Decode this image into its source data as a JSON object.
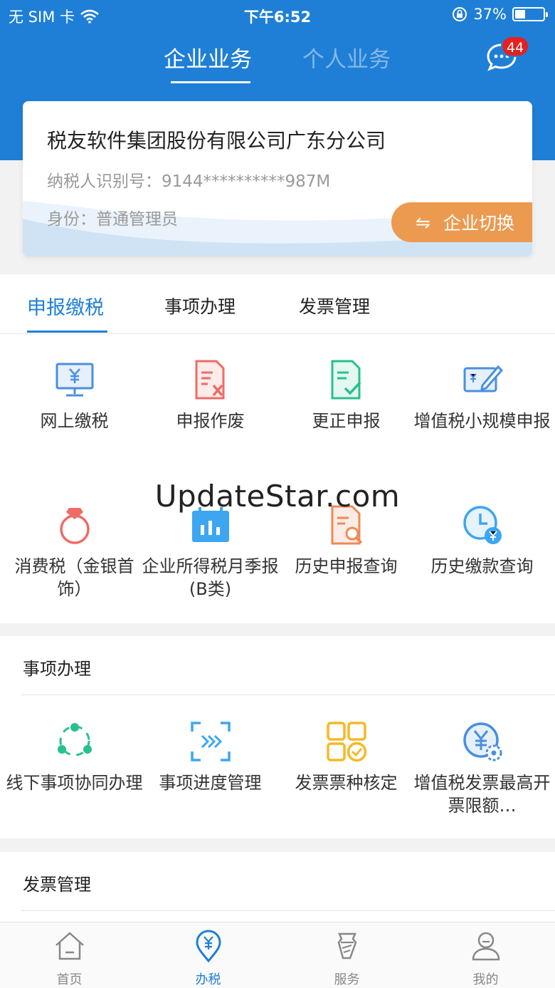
{
  "status_bar": {
    "carrier": "无 SIM 卡",
    "time": "下午6:52",
    "battery": "37%",
    "battery_level": 0.37
  },
  "header": {
    "tabs": [
      {
        "label": "企业业务"
      },
      {
        "label": "个人业务"
      }
    ],
    "message_badge": "44"
  },
  "company_card": {
    "name": "税友软件集团股份有限公司广东分公司",
    "taxpayer_id": "纳税人识别号：9144**********987M",
    "role": "身份：普通管理员",
    "switch_label": "企业切换",
    "switch_icon": "⇋"
  },
  "tabs": [
    {
      "label": "申报缴税"
    },
    {
      "label": "事项办理"
    },
    {
      "label": "发票管理"
    }
  ],
  "grid_declare": [
    {
      "label": "网上缴税",
      "icon": "monitor-yuan-icon"
    },
    {
      "label": "申报作废",
      "icon": "document-cancel-icon"
    },
    {
      "label": "更正申报",
      "icon": "document-check-icon"
    },
    {
      "label": "增值税小规模申报",
      "icon": "card-edit-icon"
    },
    {
      "label": "消费税（金银首饰）",
      "icon": "ring-icon"
    },
    {
      "label": "企业所得税月季报(B类)",
      "icon": "calendar-chart-icon"
    },
    {
      "label": "历史申报查询",
      "icon": "document-search-icon"
    },
    {
      "label": "历史缴款查询",
      "icon": "clock-yuan-icon"
    }
  ],
  "watermark": "UpdateStar.com",
  "section_matters": {
    "title": "事项办理",
    "items": [
      {
        "label": "线下事项协同办理",
        "icon": "nodes-icon"
      },
      {
        "label": "事项进度管理",
        "icon": "progress-scan-icon"
      },
      {
        "label": "发票票种核定",
        "icon": "grid-check-icon"
      },
      {
        "label": "增值税发票最高开票限额…",
        "icon": "yuan-gear-icon"
      }
    ]
  },
  "section_invoice": {
    "title": "发票管理"
  },
  "bottom_nav": [
    {
      "label": "首页",
      "icon": "home-icon"
    },
    {
      "label": "办税",
      "icon": "tax-pin-icon"
    },
    {
      "label": "服务",
      "icon": "service-icon"
    },
    {
      "label": "我的",
      "icon": "user-icon"
    }
  ],
  "colors": {
    "brand_blue": "#1f7fd6",
    "switch_orange": "#ec9a50",
    "badge_red": "#e62020"
  }
}
